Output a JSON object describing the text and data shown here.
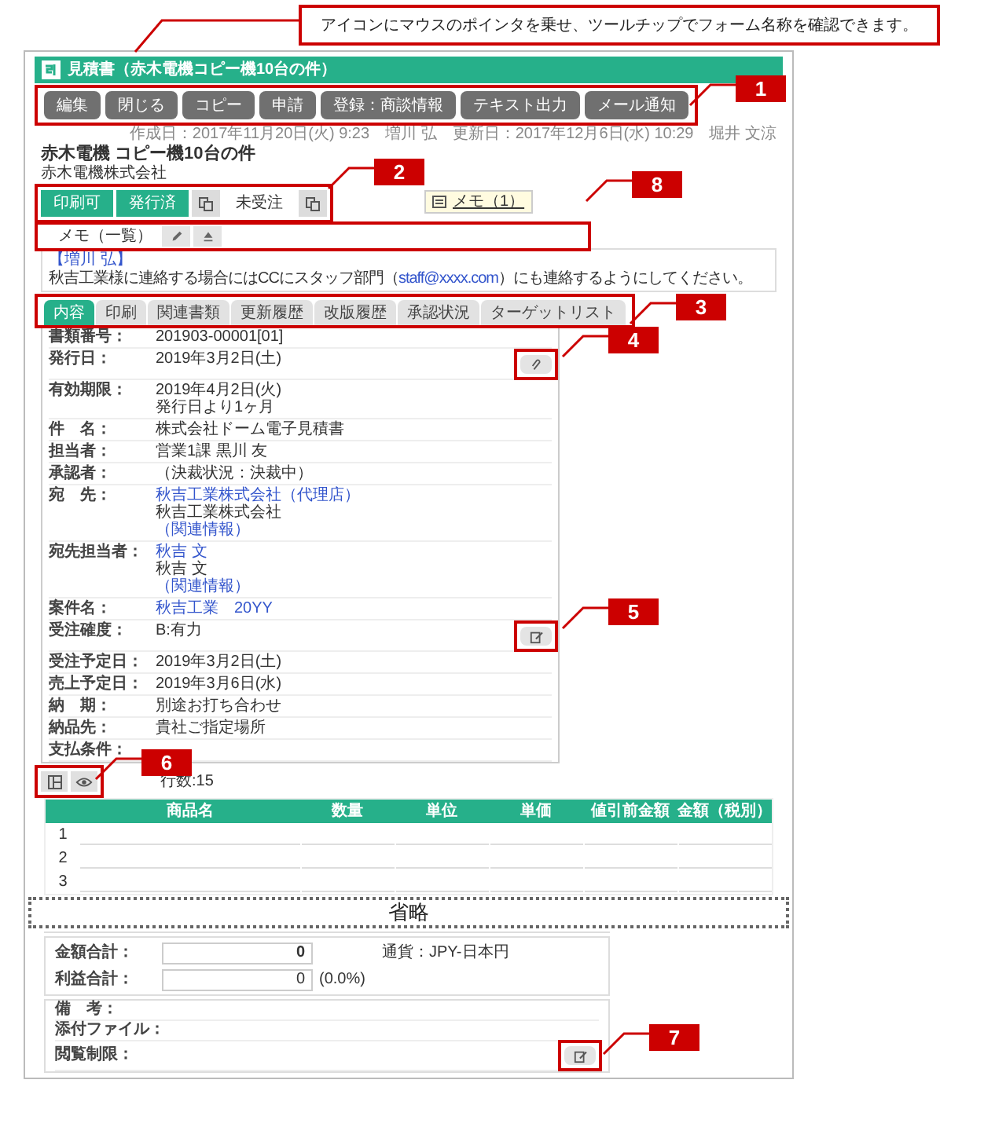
{
  "note": "アイコンにマウスのポインタを乗せ、ツールチップでフォーム名称を確認できます。",
  "window": {
    "title": "見積書（赤木電機コピー機10台の件）"
  },
  "toolbar": {
    "callout": "1",
    "buttons": [
      "編集",
      "閉じる",
      "コピー",
      "申請",
      "登録：商談情報",
      "テキスト出力",
      "メール通知"
    ]
  },
  "meta": "作成日：2017年11月20日(火) 9:23　増川 弘　更新日：2017年12月6日(水) 10:29　堀井 文涼",
  "document": {
    "title": "赤木電機 コピー機10台の件",
    "company": "赤木電機株式会社"
  },
  "status": {
    "callout": "2",
    "items": [
      {
        "kind": "status",
        "label": "印刷可",
        "on": true
      },
      {
        "kind": "status",
        "label": "発行済",
        "on": true
      },
      {
        "kind": "copy"
      },
      {
        "kind": "status",
        "label": "未受注",
        "on": false
      },
      {
        "kind": "copy"
      }
    ]
  },
  "memo_button": "メモ（1）",
  "memo": {
    "callout": "8",
    "title": "メモ（一覧）",
    "author": "【増川 弘】",
    "text_before": "秋吉工業様に連絡する場合にはCCにスタッフ部門（",
    "link": "staff@xxxx.com",
    "text_after": "）にも連絡するようにしてください。"
  },
  "tabs": {
    "callout": "3",
    "items": [
      {
        "label": "内容",
        "selected": true
      },
      {
        "label": "印刷",
        "selected": false
      },
      {
        "label": "関連書類",
        "selected": false
      },
      {
        "label": "更新履歴",
        "selected": false
      },
      {
        "label": "改版履歴",
        "selected": false
      },
      {
        "label": "承認状況",
        "selected": false
      },
      {
        "label": "ターゲットリスト",
        "selected": false
      }
    ]
  },
  "details": [
    {
      "label": "書類番号：",
      "lines": [
        {
          "text": "201903-00001[01]",
          "link": false
        }
      ]
    },
    {
      "label": "発行日：",
      "lines": [
        {
          "text": "2019年3月2日(土)",
          "link": false
        }
      ],
      "action": {
        "kind": "attach",
        "callout": "4"
      }
    },
    {
      "label": "有効期限：",
      "lines": [
        {
          "text": "2019年4月2日(火)",
          "link": false
        },
        {
          "text": "発行日より1ヶ月",
          "link": false
        }
      ]
    },
    {
      "label": "件　名：",
      "lines": [
        {
          "text": "株式会社ドーム電子見積書",
          "link": false
        }
      ]
    },
    {
      "label": "担当者：",
      "lines": [
        {
          "text": "営業1課 黒川 友",
          "link": false
        }
      ]
    },
    {
      "label": "承認者：",
      "lines": [
        {
          "text": "（決裁状況：決裁中）",
          "link": false
        }
      ]
    },
    {
      "label": "宛　先：",
      "lines": [
        {
          "text": "秋吉工業株式会社（代理店）",
          "link": true
        },
        {
          "text": "秋吉工業株式会社",
          "link": false
        },
        {
          "text": "（関連情報）",
          "link": true
        }
      ]
    },
    {
      "label": "宛先担当者：",
      "lines": [
        {
          "text": "秋吉 文",
          "link": true
        },
        {
          "text": "秋吉 文",
          "link": false
        },
        {
          "text": "（関連情報）",
          "link": true
        }
      ]
    },
    {
      "label": "案件名：",
      "lines": [
        {
          "text": "秋吉工業　20YY",
          "link": true
        }
      ]
    },
    {
      "label": "受注確度：",
      "lines": [
        {
          "text": "B:有力",
          "link": false
        }
      ],
      "action": {
        "kind": "edit",
        "callout": "5"
      }
    },
    {
      "label": "受注予定日：",
      "lines": [
        {
          "text": "2019年3月2日(土)",
          "link": false
        }
      ]
    },
    {
      "label": "売上予定日：",
      "lines": [
        {
          "text": "2019年3月6日(水)",
          "link": false
        }
      ]
    },
    {
      "label": "納　期：",
      "lines": [
        {
          "text": "別途お打ち合わせ",
          "link": false
        }
      ]
    },
    {
      "label": "納品先：",
      "lines": [
        {
          "text": "貴社ご指定場所",
          "link": false
        }
      ]
    },
    {
      "label": "支払条件："
    }
  ],
  "line_items": {
    "callout": "6",
    "row_count": "行数:15",
    "columns": [
      "商品名",
      "数量",
      "単位",
      "単価",
      "値引前金額",
      "金額（税別）"
    ],
    "rows": [
      "1",
      "2",
      "3"
    ]
  },
  "omitted": "省略",
  "totals": [
    {
      "label": "金額合計：",
      "value": "0",
      "bold": true,
      "note": "通貨：JPY-日本円"
    },
    {
      "label": "利益合計：",
      "value": "0",
      "bold": false,
      "note": "(0.0%)"
    }
  ],
  "remarks": {
    "callout": "7",
    "rows": [
      "備　考：",
      "添付ファイル：",
      "閲覧制限："
    ]
  }
}
